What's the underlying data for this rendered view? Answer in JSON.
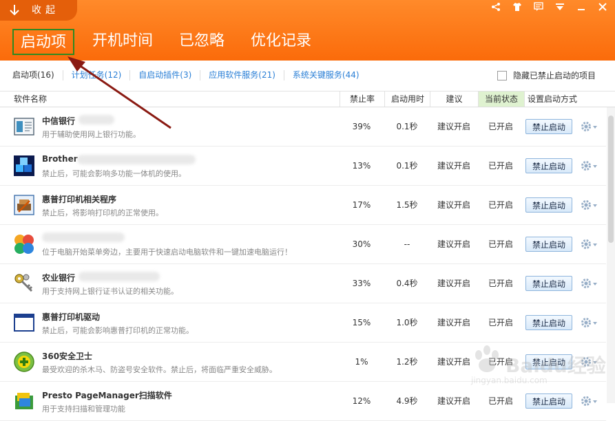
{
  "header": {
    "collapse_label": "收起",
    "main_tabs": [
      {
        "label": "启动项",
        "active": true
      },
      {
        "label": "开机时间",
        "active": false
      },
      {
        "label": "已忽略",
        "active": false
      },
      {
        "label": "优化记录",
        "active": false
      }
    ],
    "window_icons": [
      "share-icon",
      "shirt-icon",
      "message-icon",
      "menu-icon",
      "minimize-icon",
      "close-icon"
    ]
  },
  "subtabs": {
    "items": [
      "启动项(16)",
      "计划任务(12)",
      "自启动插件(3)",
      "应用软件服务(21)",
      "系统关键服务(44)"
    ],
    "hide_label": "隐藏已禁止启动的项目"
  },
  "columns": {
    "name": "软件名称",
    "rate": "禁止率",
    "time": "启动用时",
    "suggestion": "建议",
    "status": "当前状态",
    "action": "设置启动方式"
  },
  "rows": [
    {
      "name": "中信银行",
      "desc": "用于辅助使用网上银行功能。",
      "rate": "39%",
      "time": "0.1秒",
      "suggestion": "建议开启",
      "status": "已开启",
      "button": "禁止启动"
    },
    {
      "name": "Brother",
      "desc": "禁止后，可能会影响多功能一体机的使用。",
      "rate": "13%",
      "time": "0.1秒",
      "suggestion": "建议开启",
      "status": "已开启",
      "button": "禁止启动"
    },
    {
      "name": "惠普打印机相关程序",
      "desc": "禁止后，将影响打印机的正常使用。",
      "rate": "17%",
      "time": "1.5秒",
      "suggestion": "建议开启",
      "status": "已开启",
      "button": "禁止启动"
    },
    {
      "name": "",
      "desc": "位于电脑开始菜单旁边，主要用于快速启动电脑软件和一键加速电脑运行！",
      "rate": "30%",
      "time": "--",
      "suggestion": "建议开启",
      "status": "已开启",
      "button": "禁止启动"
    },
    {
      "name": "农业银行",
      "desc": "用于支持网上银行证书认证的相关功能。",
      "rate": "33%",
      "time": "0.4秒",
      "suggestion": "建议开启",
      "status": "已开启",
      "button": "禁止启动"
    },
    {
      "name": "惠普打印机驱动",
      "desc": "禁止后，可能会影响惠普打印机的正常功能。",
      "rate": "15%",
      "time": "1.0秒",
      "suggestion": "建议开启",
      "status": "已开启",
      "button": "禁止启动"
    },
    {
      "name": "360安全卫士",
      "desc": "最受欢迎的杀木马、防盗号安全软件。禁止后，将面临严重安全威胁。",
      "rate": "1%",
      "time": "1.2秒",
      "suggestion": "建议开启",
      "status": "已开启",
      "button": "禁止启动"
    },
    {
      "name": "Presto PageManager扫描软件",
      "desc": "用于支持扫描和管理功能",
      "rate": "12%",
      "time": "4.9秒",
      "suggestion": "建议开启",
      "status": "已开启",
      "button": "禁止启动"
    }
  ],
  "watermark": {
    "text": "Baidu经验",
    "sub": "jingyan.baidu.com"
  },
  "colors": {
    "header_orange": "#fb6b0a",
    "active_tab_border": "#2b8a22",
    "link_blue": "#2a7fd6",
    "status_bg": "#dff2d0",
    "arrow": "#8a1a12"
  }
}
